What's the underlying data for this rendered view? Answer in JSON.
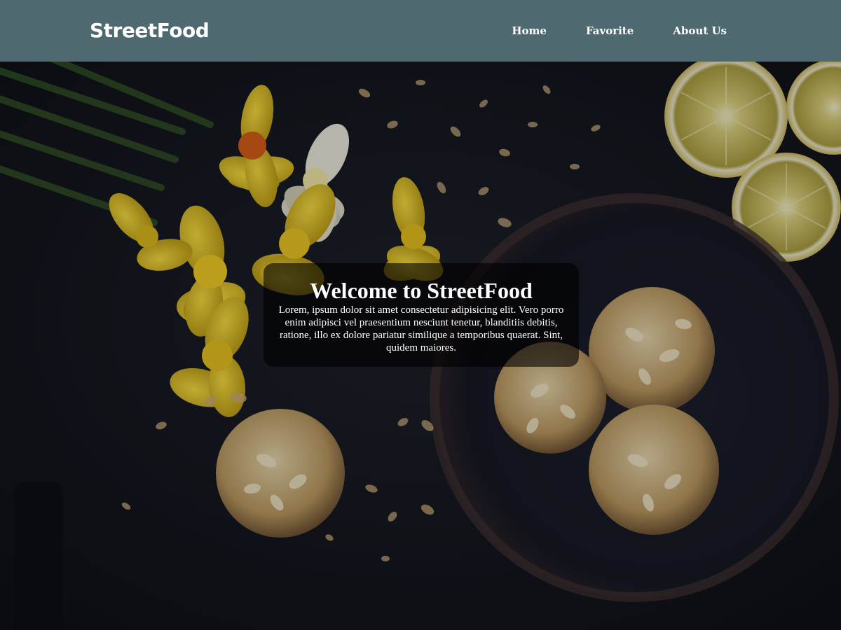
{
  "header": {
    "logo": "StreetFood",
    "nav": [
      {
        "label": "Home"
      },
      {
        "label": "Favorite"
      },
      {
        "label": "About Us"
      }
    ]
  },
  "hero": {
    "title": "Welcome to StreetFood",
    "description": "Lorem, ipsum dolor sit amet consectetur adipisicing elit. Vero porro enim adipisci vel praesentium nesciunt tenetur, blanditiis debitis, ratione, illo ex dolore pariatur similique a temporibus quaerat. Sint, quidem maiores."
  },
  "colors": {
    "navbar": "#4e6a70",
    "background": "#15161d",
    "text": "#ffffff"
  },
  "icons": [
    "food-photo"
  ]
}
